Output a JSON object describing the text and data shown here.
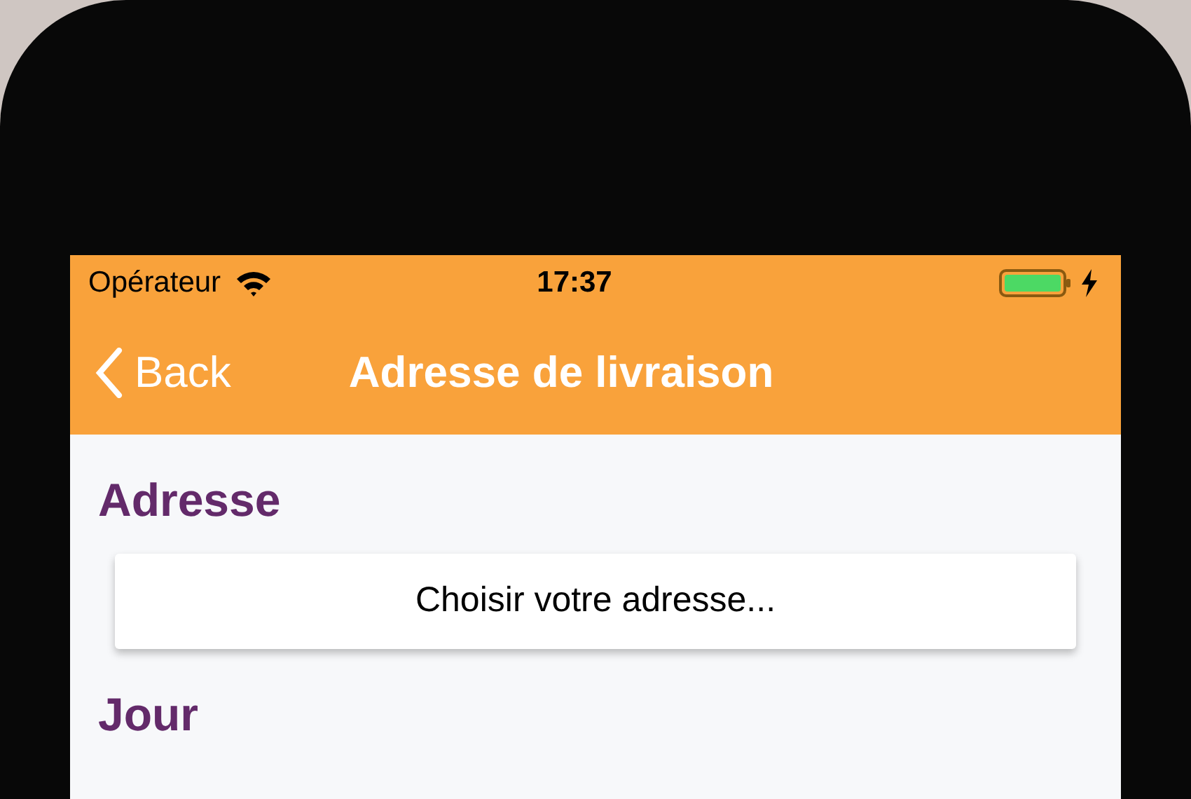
{
  "status_bar": {
    "carrier": "Opérateur",
    "time": "17:37"
  },
  "nav_bar": {
    "back": "Back",
    "title": "Adresse de livraison"
  },
  "sections": [
    {
      "heading": "Adresse",
      "button": "Choisir votre adresse..."
    },
    {
      "heading": "Jour"
    }
  ]
}
